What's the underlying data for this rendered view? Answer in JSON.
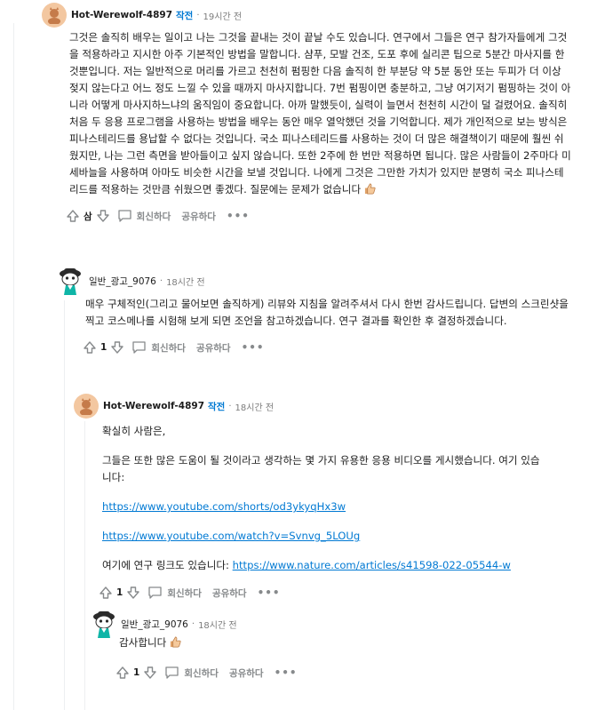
{
  "comments": [
    {
      "author": "Hot-Werewolf-4897",
      "op_badge": "작전",
      "time": "19시간 전",
      "body": "그것은 솔직히 배우는 일이고 나는 그것을 끝내는 것이 끝날 수도 있습니다. 연구에서 그들은 연구 참가자들에게 그것을 적용하라고 지시한 아주 기본적인 방법을 말합니다. 샴푸, 모발 건조, 도포 후에 실리콘 팁으로 5분간 마사지를 한 것뿐입니다. 저는 일반적으로 머리를 가르고 천천히 펌핑한 다음 솔직히 한 부분당 약 5분 동안 또는 두피가 더 이상 젖지 않는다고 어느 정도 느낄 수 있을 때까지 마사지합니다. 7번 펌핑이면 충분하고, 그냥 여기저기 펌핑하는 것이 아니라 어떻게 마사지하느냐의 움직임이 중요합니다. 아까 말했듯이, 실력이 늘면서 천천히 시간이 덜 걸렸어요. 솔직히 처음 두 응용 프로그램을 사용하는 방법을 배우는 동안 매우 열악했던 것을 기억합니다. 제가 개인적으로 보는 방식은 피나스테리드를 용납할 수 없다는 것입니다. 국소 피나스테리드를 사용하는 것이 더 많은 해결책이기 때문에 훨씬 쉬웠지만, 나는 그런 측면을 받아들이고 싶지 않습니다. 또한 2주에 한 번만 적용하면 됩니다. 많은 사람들이 2주마다 미세바늘을 사용하며 아마도 비슷한 시간을 보낼 것입니다. 나에게 그것은 그만한 가치가 있지만 분명히 국소 피나스테리드를 적용하는 것만큼 쉬웠으면 좋겠다. 질문에는 문제가 없습니다",
      "vote": "삼",
      "reply": "회신하다",
      "share": "공유하다",
      "more": "•••"
    },
    {
      "author": "일반_광고_9076",
      "time": "18시간 전",
      "body": "매우 구체적인(그리고 물어보면 솔직하게) 리뷰와 지침을 알려주셔서 다시 한번 감사드립니다. 답변의 스크린샷을 찍고 코스메나를 시험해 보게 되면 조언을 참고하겠습니다. 연구 결과를 확인한 후 결정하겠습니다.",
      "vote": "1",
      "reply": "회신하다",
      "share": "공유하다",
      "more": "•••"
    },
    {
      "author": "Hot-Werewolf-4897",
      "op_badge": "작전",
      "time": "18시간 전",
      "greeting": "확실히 사람은,",
      "para": "그들은 또한 많은 도움이 될 것이라고 생각하는 몇 가지 유용한 응용 비디오를 게시했습니다. 여기 있습니다:",
      "link1": "https://www.youtube.com/shorts/od3ykyqHx3w",
      "link2": "https://www.youtube.com/watch?v=Svnvg_5LOUg",
      "study_prefix": "여기에 연구 링크도 있습니다: ",
      "link3": "https://www.nature.com/articles/s41598-022-05544-w",
      "vote": "1",
      "reply": "회신하다",
      "share": "공유하다",
      "more": "•••"
    },
    {
      "author": "일반_광고_9076",
      "time": "18시간 전",
      "body": "감사합니다",
      "vote": "1",
      "reply": "회신하다",
      "share": "공유하다",
      "more": "•••"
    }
  ],
  "colors": {
    "op": "#0079d3",
    "link": "#0079d3",
    "meta": "#7c7c7c",
    "thread": "#edeff1"
  },
  "icons": [
    "upvote-icon",
    "downvote-icon",
    "comment-icon",
    "thumbs-up-emoji",
    "avatar-werewolf",
    "avatar-snoo"
  ]
}
